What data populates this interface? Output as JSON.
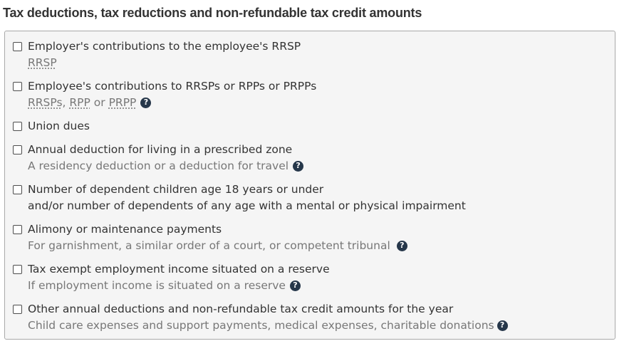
{
  "heading": "Tax deductions, tax reductions and non-refundable tax credit amounts",
  "help_glyph": "?",
  "items": [
    {
      "label": "Employer's contributions to the employee's RRSP",
      "sub_abbr_1": "RRSP"
    },
    {
      "label": "Employee's contributions to RRSPs or RPPs or PRPPs",
      "sub_abbr_1": "RRSPs",
      "sub_sep_1": ", ",
      "sub_abbr_2": "RPP",
      "sub_sep_2": " or ",
      "sub_abbr_3": "PRPP"
    },
    {
      "label": "Union dues"
    },
    {
      "label": "Annual deduction for living in a prescribed zone",
      "sub": "A residency deduction or a deduction for travel"
    },
    {
      "label": "Number of dependent children age 18 years or under",
      "sub": "and/or number of dependents of any age with a mental or physical impairment"
    },
    {
      "label": "Alimony or maintenance payments",
      "sub": "For garnishment, a similar order of a court, or competent tribunal"
    },
    {
      "label": "Tax exempt employment income situated on a reserve",
      "sub": "If employment income is situated on a reserve"
    },
    {
      "label": "Other annual deductions and non-refundable tax credit amounts for the year",
      "sub": "Child care expenses and support payments, medical expenses, charitable donations"
    }
  ],
  "colors": {
    "help_icon": "#26374a",
    "muted_text": "#777777",
    "panel_background": "#f5f5f5"
  },
  "icons": {
    "help": "question-circle-icon"
  }
}
